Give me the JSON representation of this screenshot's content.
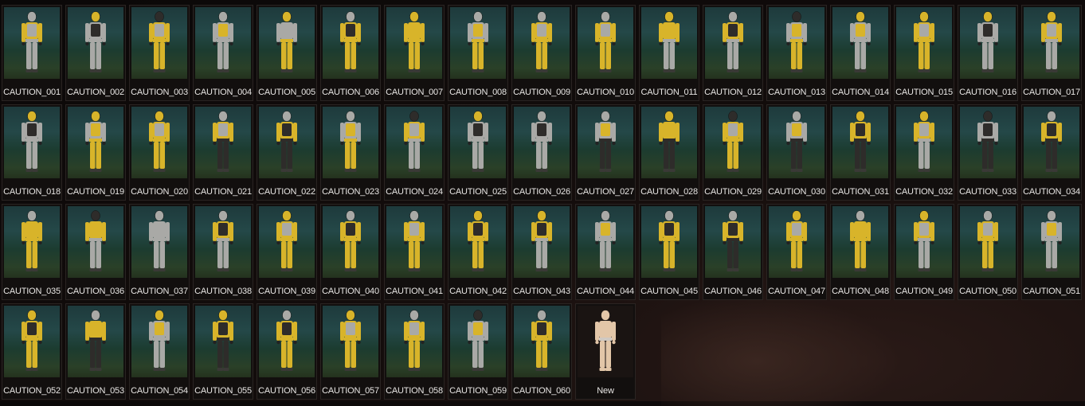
{
  "outfits": [
    {
      "label": "CAUTION_001",
      "suit": "yellow",
      "legs": "gray",
      "vest": "gray",
      "helmet": "gray"
    },
    {
      "label": "CAUTION_002",
      "suit": "gray",
      "legs": "gray",
      "vest": "dark",
      "helmet": "yellow"
    },
    {
      "label": "CAUTION_003",
      "suit": "yellow",
      "legs": "yellow",
      "vest": "gray",
      "helmet": "dark"
    },
    {
      "label": "CAUTION_004",
      "suit": "gray",
      "legs": "gray",
      "vest": "yellow",
      "helmet": "gray"
    },
    {
      "label": "CAUTION_005",
      "suit": "gray",
      "legs": "yellow",
      "vest": "gray",
      "helmet": "yellow"
    },
    {
      "label": "CAUTION_006",
      "suit": "yellow",
      "legs": "yellow",
      "vest": "dark",
      "helmet": "gray"
    },
    {
      "label": "CAUTION_007",
      "suit": "yellow",
      "legs": "yellow",
      "vest": "yellow",
      "helmet": "yellow"
    },
    {
      "label": "CAUTION_008",
      "suit": "gray",
      "legs": "yellow",
      "vest": "yellow",
      "helmet": "gray"
    },
    {
      "label": "CAUTION_009",
      "suit": "yellow",
      "legs": "yellow",
      "vest": "gray",
      "helmet": "gray"
    },
    {
      "label": "CAUTION_010",
      "suit": "yellow",
      "legs": "yellow",
      "vest": "gray",
      "helmet": "gray"
    },
    {
      "label": "CAUTION_011",
      "suit": "yellow",
      "legs": "gray",
      "vest": "yellow",
      "helmet": "yellow"
    },
    {
      "label": "CAUTION_012",
      "suit": "yellow",
      "legs": "gray",
      "vest": "dark",
      "helmet": "gray"
    },
    {
      "label": "CAUTION_013",
      "suit": "gray",
      "legs": "yellow",
      "vest": "yellow",
      "helmet": "dark"
    },
    {
      "label": "CAUTION_014",
      "suit": "gray",
      "legs": "gray",
      "vest": "yellow",
      "helmet": "yellow"
    },
    {
      "label": "CAUTION_015",
      "suit": "yellow",
      "legs": "yellow",
      "vest": "gray",
      "helmet": "yellow"
    },
    {
      "label": "CAUTION_016",
      "suit": "gray",
      "legs": "gray",
      "vest": "dark",
      "helmet": "yellow"
    },
    {
      "label": "CAUTION_017",
      "suit": "yellow",
      "legs": "gray",
      "vest": "gray",
      "helmet": "yellow"
    },
    {
      "label": "CAUTION_018",
      "suit": "gray",
      "legs": "gray",
      "vest": "dark",
      "helmet": "yellow"
    },
    {
      "label": "CAUTION_019",
      "suit": "gray",
      "legs": "yellow",
      "vest": "yellow",
      "helmet": "yellow"
    },
    {
      "label": "CAUTION_020",
      "suit": "yellow",
      "legs": "yellow",
      "vest": "gray",
      "helmet": "yellow"
    },
    {
      "label": "CAUTION_021",
      "suit": "yellow",
      "legs": "dark",
      "vest": "gray",
      "helmet": "gray"
    },
    {
      "label": "CAUTION_022",
      "suit": "yellow",
      "legs": "dark",
      "vest": "dark",
      "helmet": "gray"
    },
    {
      "label": "CAUTION_023",
      "suit": "gray",
      "legs": "yellow",
      "vest": "yellow",
      "helmet": "gray"
    },
    {
      "label": "CAUTION_024",
      "suit": "yellow",
      "legs": "gray",
      "vest": "gray",
      "helmet": "dark"
    },
    {
      "label": "CAUTION_025",
      "suit": "gray",
      "legs": "gray",
      "vest": "dark",
      "helmet": "yellow"
    },
    {
      "label": "CAUTION_026",
      "suit": "gray",
      "legs": "gray",
      "vest": "dark",
      "helmet": "gray"
    },
    {
      "label": "CAUTION_027",
      "suit": "gray",
      "legs": "dark",
      "vest": "yellow",
      "helmet": "gray"
    },
    {
      "label": "CAUTION_028",
      "suit": "yellow",
      "legs": "dark",
      "vest": "yellow",
      "helmet": "yellow"
    },
    {
      "label": "CAUTION_029",
      "suit": "yellow",
      "legs": "yellow",
      "vest": "gray",
      "helmet": "dark"
    },
    {
      "label": "CAUTION_030",
      "suit": "gray",
      "legs": "dark",
      "vest": "yellow",
      "helmet": "gray"
    },
    {
      "label": "CAUTION_031",
      "suit": "yellow",
      "legs": "dark",
      "vest": "dark",
      "helmet": "yellow"
    },
    {
      "label": "CAUTION_032",
      "suit": "yellow",
      "legs": "gray",
      "vest": "gray",
      "helmet": "yellow"
    },
    {
      "label": "CAUTION_033",
      "suit": "gray",
      "legs": "dark",
      "vest": "dark",
      "helmet": "dark"
    },
    {
      "label": "CAUTION_034",
      "suit": "yellow",
      "legs": "dark",
      "vest": "dark",
      "helmet": "gray"
    },
    {
      "label": "CAUTION_035",
      "suit": "yellow",
      "legs": "yellow",
      "vest": "yellow",
      "helmet": "gray"
    },
    {
      "label": "CAUTION_036",
      "suit": "yellow",
      "legs": "gray",
      "vest": "yellow",
      "helmet": "dark"
    },
    {
      "label": "CAUTION_037",
      "suit": "gray",
      "legs": "gray",
      "vest": "gray",
      "helmet": "gray"
    },
    {
      "label": "CAUTION_038",
      "suit": "yellow",
      "legs": "gray",
      "vest": "dark",
      "helmet": "gray"
    },
    {
      "label": "CAUTION_039",
      "suit": "yellow",
      "legs": "yellow",
      "vest": "gray",
      "helmet": "yellow"
    },
    {
      "label": "CAUTION_040",
      "suit": "yellow",
      "legs": "yellow",
      "vest": "dark",
      "helmet": "gray"
    },
    {
      "label": "CAUTION_041",
      "suit": "yellow",
      "legs": "yellow",
      "vest": "gray",
      "helmet": "gray"
    },
    {
      "label": "CAUTION_042",
      "suit": "yellow",
      "legs": "yellow",
      "vest": "dark",
      "helmet": "yellow"
    },
    {
      "label": "CAUTION_043",
      "suit": "yellow",
      "legs": "gray",
      "vest": "dark",
      "helmet": "yellow"
    },
    {
      "label": "CAUTION_044",
      "suit": "gray",
      "legs": "gray",
      "vest": "yellow",
      "helmet": "gray"
    },
    {
      "label": "CAUTION_045",
      "suit": "yellow",
      "legs": "yellow",
      "vest": "dark",
      "helmet": "gray"
    },
    {
      "label": "CAUTION_046",
      "suit": "yellow",
      "legs": "dark",
      "vest": "dark",
      "helmet": "gray"
    },
    {
      "label": "CAUTION_047",
      "suit": "yellow",
      "legs": "yellow",
      "vest": "gray",
      "helmet": "yellow"
    },
    {
      "label": "CAUTION_048",
      "suit": "yellow",
      "legs": "yellow",
      "vest": "yellow",
      "helmet": "gray"
    },
    {
      "label": "CAUTION_049",
      "suit": "yellow",
      "legs": "gray",
      "vest": "gray",
      "helmet": "yellow"
    },
    {
      "label": "CAUTION_050",
      "suit": "yellow",
      "legs": "yellow",
      "vest": "gray",
      "helmet": "gray"
    },
    {
      "label": "CAUTION_051",
      "suit": "gray",
      "legs": "gray",
      "vest": "yellow",
      "helmet": "gray"
    },
    {
      "label": "CAUTION_052",
      "suit": "yellow",
      "legs": "yellow",
      "vest": "dark",
      "helmet": "yellow"
    },
    {
      "label": "CAUTION_053",
      "suit": "yellow",
      "legs": "dark",
      "vest": "yellow",
      "helmet": "gray"
    },
    {
      "label": "CAUTION_054",
      "suit": "gray",
      "legs": "gray",
      "vest": "yellow",
      "helmet": "yellow"
    },
    {
      "label": "CAUTION_055",
      "suit": "yellow",
      "legs": "dark",
      "vest": "dark",
      "helmet": "yellow"
    },
    {
      "label": "CAUTION_056",
      "suit": "yellow",
      "legs": "yellow",
      "vest": "dark",
      "helmet": "gray"
    },
    {
      "label": "CAUTION_057",
      "suit": "yellow",
      "legs": "yellow",
      "vest": "gray",
      "helmet": "yellow"
    },
    {
      "label": "CAUTION_058",
      "suit": "yellow",
      "legs": "yellow",
      "vest": "gray",
      "helmet": "gray"
    },
    {
      "label": "CAUTION_059",
      "suit": "gray",
      "legs": "gray",
      "vest": "yellow",
      "helmet": "dark"
    },
    {
      "label": "CAUTION_060",
      "suit": "yellow",
      "legs": "yellow",
      "vest": "dark",
      "helmet": "gray"
    }
  ],
  "new_item": {
    "label": "New"
  },
  "colors": {
    "yellow": "#d8b42a",
    "gray": "#a9a9a6",
    "dark": "#2e2c2a",
    "skin": "#e2c6a8",
    "accent_border": "#2a2422"
  }
}
